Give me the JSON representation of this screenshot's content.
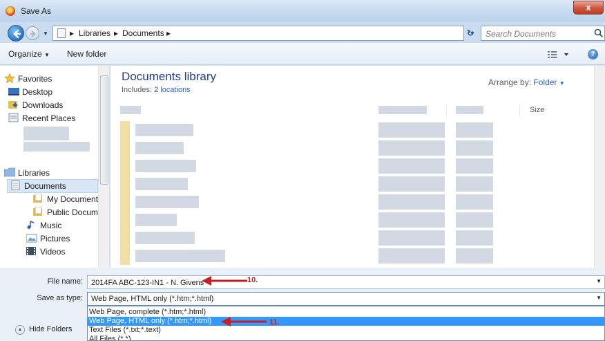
{
  "window": {
    "title": "Save As",
    "close_label": "x"
  },
  "address": {
    "segments": [
      "Libraries",
      "Documents"
    ],
    "search_placeholder": "Search Documents"
  },
  "toolbar": {
    "organize_label": "Organize",
    "new_folder_label": "New folder"
  },
  "nav": {
    "favorites": "Favorites",
    "desktop": "Desktop",
    "downloads": "Downloads",
    "recent_places": "Recent Places",
    "libraries": "Libraries",
    "documents": "Documents",
    "my_documents": "My Documents",
    "public_documents": "Public Docume",
    "music": "Music",
    "pictures": "Pictures",
    "videos": "Videos"
  },
  "library": {
    "title": "Documents library",
    "includes_label": "Includes:",
    "locations_link": "2 locations",
    "arrange_label": "Arrange by:",
    "arrange_value": "Folder",
    "size_header": "Size"
  },
  "footer": {
    "file_name_label": "File name:",
    "file_name_value": "2014FA ABC-123-IN1 - N. Givens",
    "save_type_label": "Save as type:",
    "save_type_value": "Web Page, HTML only (*.htm;*.html)",
    "type_options": [
      "Web Page, complete (*.htm;*.html)",
      "Web Page, HTML only (*.htm;*.html)",
      "Text Files (*.txt;*.text)",
      "All Files (*.*)"
    ],
    "hide_folders_label": "Hide Folders"
  },
  "annotations": {
    "step_10": "10.",
    "step_11": "11."
  },
  "colors": {
    "accent": "#3399ff",
    "annotation": "#c81f1f",
    "library_title": "#1e3e8c"
  }
}
